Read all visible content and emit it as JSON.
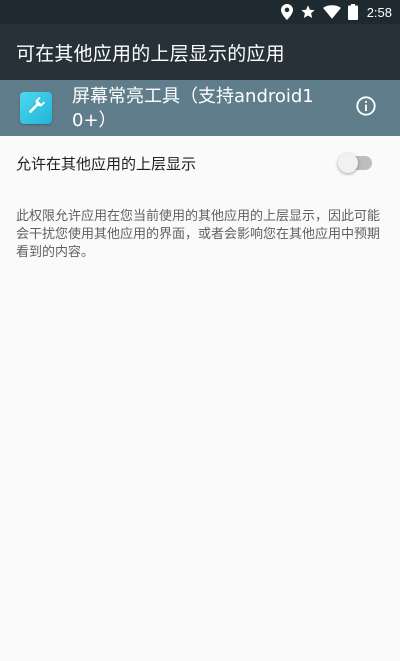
{
  "status_bar": {
    "time": "2:58",
    "icons": [
      "location-icon",
      "star-icon",
      "wifi-icon",
      "battery-icon"
    ]
  },
  "app_bar": {
    "title": "可在其他应用的上层显示的应用"
  },
  "app_header": {
    "app_name": "屏幕常亮工具（支持android10+）",
    "icon": "wrench-icon",
    "info_icon": "info-icon"
  },
  "setting": {
    "label": "允许在其他应用的上层显示",
    "enabled": false
  },
  "description": "此权限允许应用在您当前使用的其他应用的上层显示，因此可能会干扰您使用其他应用的界面，或者会影响您在其他应用中预期看到的内容。",
  "colors": {
    "status_bar": "#1f2a30",
    "app_bar": "#263238",
    "app_header": "#607d8b",
    "background": "#fafafa",
    "app_icon": "#29c0e0"
  }
}
